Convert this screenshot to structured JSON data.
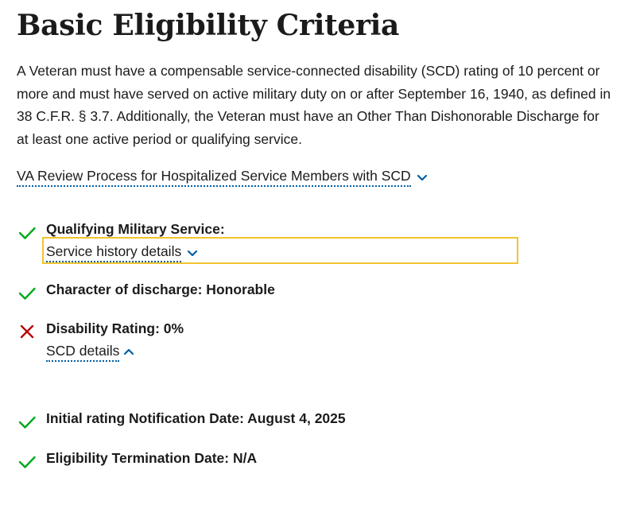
{
  "page": {
    "title": "Basic Eligibility Criteria",
    "intro": "A Veteran must have a compensable service-connected disability (SCD) rating of 10 percent or more and must have served on active military duty on or after September 16, 1940, as defined in 38 C.F.R. § 3.7. Additionally, the Veteran must have an Other Than Dishonorable Discharge for at least one active period or qualifying service.",
    "review_link": {
      "label": "VA Review Process for Hospitalized Service Members with SCD",
      "icon": "chevron-down-icon"
    }
  },
  "criteria": [
    {
      "status": "met",
      "status_icon": "checkmark-icon",
      "label": "Qualifying Military Service:",
      "toggle": {
        "label": "Service history details",
        "icon": "chevron-down-icon",
        "expanded": false
      }
    },
    {
      "status": "met",
      "status_icon": "checkmark-icon",
      "label": "Character of discharge: Honorable"
    },
    {
      "status": "not-met",
      "status_icon": "x-icon",
      "label": "Disability Rating: 0%",
      "toggle": {
        "label": "SCD details",
        "icon": "chevron-up-icon",
        "expanded": true
      }
    },
    {
      "status": "met",
      "status_icon": "checkmark-icon",
      "label": "Initial rating Notification Date: August 4, 2025"
    },
    {
      "status": "met",
      "status_icon": "checkmark-icon",
      "label": "Eligibility Termination Date: N/A"
    }
  ],
  "colors": {
    "text": "#1b1b1b",
    "link_underline": "#005ea2",
    "chevron": "#005ea2",
    "check": "#00a91c",
    "x": "#b50909",
    "focus": "#f2c330"
  }
}
